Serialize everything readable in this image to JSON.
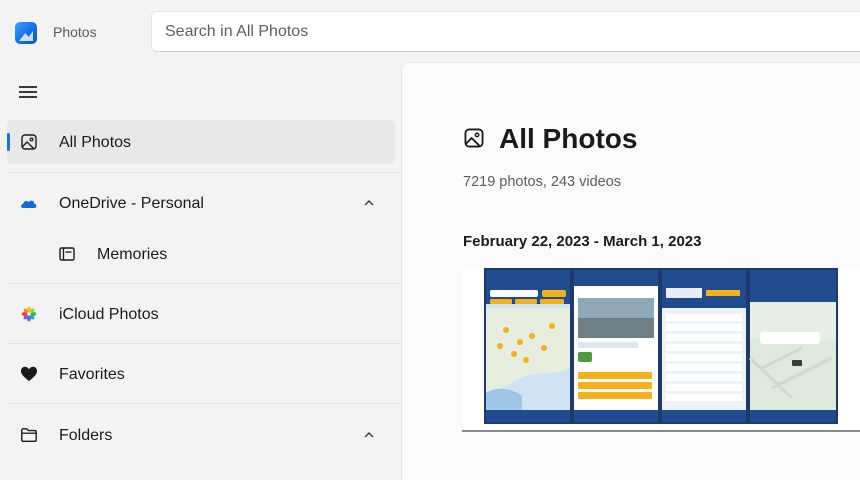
{
  "app": {
    "title": "Photos"
  },
  "search": {
    "placeholder": "Search in All Photos"
  },
  "sidebar": {
    "menu_icon": "hamburger-menu-icon",
    "items": [
      {
        "label": "All Photos",
        "icon": "photo-icon",
        "selected": true
      },
      {
        "label": "OneDrive - Personal",
        "icon": "onedrive-cloud-icon",
        "expanded": true
      },
      {
        "label": "Memories",
        "icon": "memories-icon",
        "child": true
      },
      {
        "label": "iCloud Photos",
        "icon": "icloud-photos-icon"
      },
      {
        "label": "Favorites",
        "icon": "heart-icon"
      },
      {
        "label": "Folders",
        "icon": "folder-icon",
        "expanded": true
      }
    ]
  },
  "main": {
    "title": "All Photos",
    "title_icon": "photo-icon",
    "counts": "7219 photos, 243 videos",
    "date_range": "February 22, 2023 - March 1, 2023"
  },
  "colors": {
    "accent": "#1a73d9",
    "selected_bg": "#e8e8e8",
    "window_bg": "#f3f3f3"
  }
}
